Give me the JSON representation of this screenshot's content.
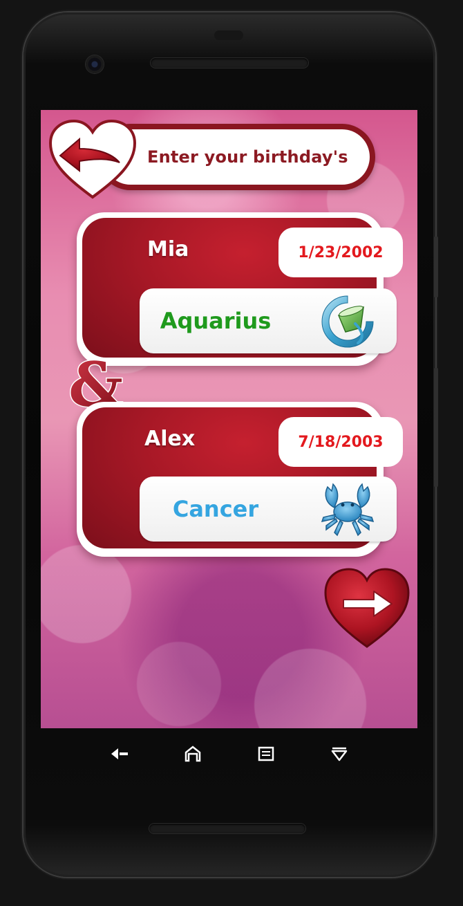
{
  "header": {
    "title": "Enter your birthday's"
  },
  "couple": {
    "person1": {
      "name": "Mia",
      "birthday": "1/23/2002",
      "sign": "Aquarius",
      "sign_color": "#1f9a1d",
      "sign_icon": "aquarius-icon"
    },
    "person2": {
      "name": "Alex",
      "birthday": "7/18/2003",
      "sign": "Cancer",
      "sign_color": "#35a5e0",
      "sign_icon": "cancer-crab-icon"
    },
    "joiner": "&"
  },
  "colors": {
    "accent": "#a71826",
    "date_text": "#e3191e",
    "header_text": "#8c1a22"
  },
  "navigation": {
    "back_icon": "back-arrow-heart-icon",
    "next_icon": "next-arrow-heart-icon"
  },
  "system_nav": {
    "buttons": [
      "back-icon",
      "home-icon",
      "recents-icon",
      "notifications-icon"
    ]
  }
}
